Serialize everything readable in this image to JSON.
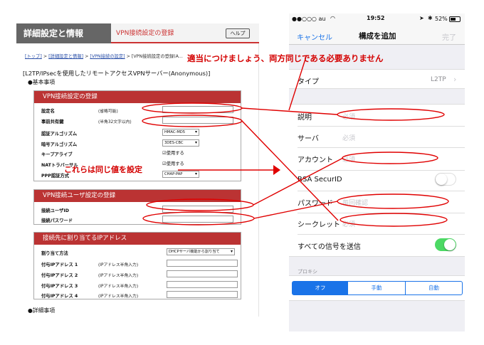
{
  "router": {
    "title": "詳細設定と情報",
    "subtitle": "VPN接続設定の登録",
    "help": "ヘルプ",
    "breadcrumb": {
      "top": "[トップ]",
      "sep1": " > ",
      "detail": "[詳細設定と情報]",
      "sep2": " > ",
      "vpn": "[VPN接続の設定]",
      "rest": " > [VPN接続設定の登録(A..."
    },
    "main_title": "[L2TP/IPsecを使用したリモートアクセスVPNサーバー(Anonymous)]",
    "basic": "●基本事項",
    "detail": "●詳細事項",
    "section1": {
      "title": "VPN接続設定の登録",
      "rows": [
        {
          "label": "設定名",
          "hint": "(省略可能)"
        },
        {
          "label": "事前共有鍵",
          "hint": "(半角32文字以内)"
        },
        {
          "label": "認証アルゴリズム",
          "value": "HMAC-MD5"
        },
        {
          "label": "暗号アルゴリズム",
          "value": "3DES-CBC"
        },
        {
          "label": "キープアライブ",
          "value": "☑使用する"
        },
        {
          "label": "NATトラバーサル",
          "value": "☑使用する"
        },
        {
          "label": "PPP認証方式",
          "value": "CHAP-PAP"
        }
      ]
    },
    "section2": {
      "title": "VPN接続ユーザ設定の登録",
      "rows": [
        {
          "label": "接続ユーザID"
        },
        {
          "label": "接続パスワード"
        }
      ]
    },
    "section3": {
      "title": "接続先に割り当てるIPアドレス",
      "method_label": "割り当て方法",
      "method_value": "DHCPサーバ機能から割り当て",
      "rows": [
        {
          "label": "付与IPアドレス 1",
          "hint": "(IPアドレス半角入力)"
        },
        {
          "label": "付与IPアドレス 2",
          "hint": "(IPアドレス半角入力)"
        },
        {
          "label": "付与IPアドレス 3",
          "hint": "(IPアドレス半角入力)"
        },
        {
          "label": "付与IPアドレス 4",
          "hint": "(IPアドレス半角入力)"
        }
      ]
    }
  },
  "phone": {
    "status": {
      "carrier": "●●○○○ au",
      "time": "19:52",
      "battery": "52%"
    },
    "nav": {
      "cancel": "キャンセル",
      "title": "構成を追加",
      "done": "完了"
    },
    "type": {
      "label": "タイプ",
      "value": "L2TP"
    },
    "fields": [
      {
        "label": "説明",
        "placeholder": "必須"
      },
      {
        "label": "サーバ",
        "placeholder": "必須"
      },
      {
        "label": "アカウント",
        "placeholder": "必須"
      },
      {
        "label": "RSA SecurID"
      },
      {
        "label": "パスワード",
        "placeholder": "毎回確認"
      },
      {
        "label": "シークレット",
        "placeholder": "必須"
      },
      {
        "label": "すべての信号を送信"
      }
    ],
    "proxy_header": "プロキシ",
    "proxy_options": [
      "オフ",
      "手動",
      "自動"
    ]
  },
  "annotations": {
    "top": "適当につけましょう、両方同じである必要ありません",
    "mid": "これらは同じ値を設定"
  },
  "colors": {
    "annotation": "#e00000",
    "router_red": "#b33333",
    "ios_blue": "#1a73e8",
    "ios_green": "#4cd964"
  }
}
